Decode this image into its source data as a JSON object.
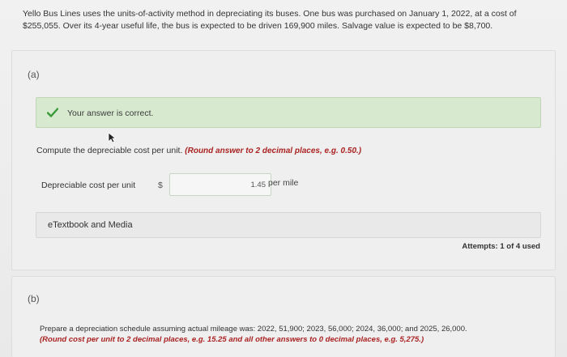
{
  "problem": {
    "text": "Yello Bus Lines uses the units-of-activity method in depreciating its buses. One bus was purchased on January 1, 2022, at a cost of $255,055. Over its 4-year useful life, the bus is expected to be driven 169,900 miles. Salvage value is expected to be $8,700."
  },
  "part_a": {
    "label": "(a)",
    "banner": {
      "text": "Your answer is correct.",
      "icon": "check-icon",
      "color": "#d7e9cf"
    },
    "instruction": "Compute the depreciable cost per unit.",
    "instruction_hint": "(Round answer to 2 decimal places, e.g. 0.50.)",
    "field": {
      "label": "Depreciable cost per unit",
      "currency": "$",
      "value": "1.45",
      "unit": "per mile"
    },
    "etextbook_label": "eTextbook and Media",
    "attempts": "Attempts: 1 of 4 used"
  },
  "part_b": {
    "label": "(b)",
    "instruction": "Prepare a depreciation schedule assuming actual mileage was: 2022, 51,900; 2023, 56,000; 2024, 36,000; and 2025, 26,000.",
    "instruction_hint": "(Round cost per unit to 2 decimal places, e.g. 15.25 and all other answers to 0 decimal places, e.g. 5,275.)"
  },
  "colors": {
    "accent_red": "#aa2222",
    "success_green": "#3a9a3a"
  }
}
